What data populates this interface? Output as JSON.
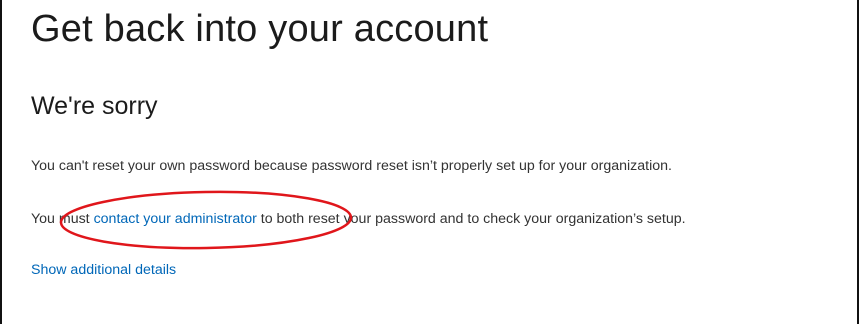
{
  "page": {
    "title": "Get back into your account",
    "heading": "We're sorry"
  },
  "messages": {
    "line1": "You can't reset your own password because password reset isn’t properly set up for your organization.",
    "line2_prefix": "You must ",
    "line2_link": "contact your administrator",
    "line2_suffix": " to both reset your password and to check your organization’s setup."
  },
  "links": {
    "show_details": "Show additional details"
  },
  "colors": {
    "link": "#0067b8",
    "annotation": "#e0161b",
    "text": "#333333"
  }
}
